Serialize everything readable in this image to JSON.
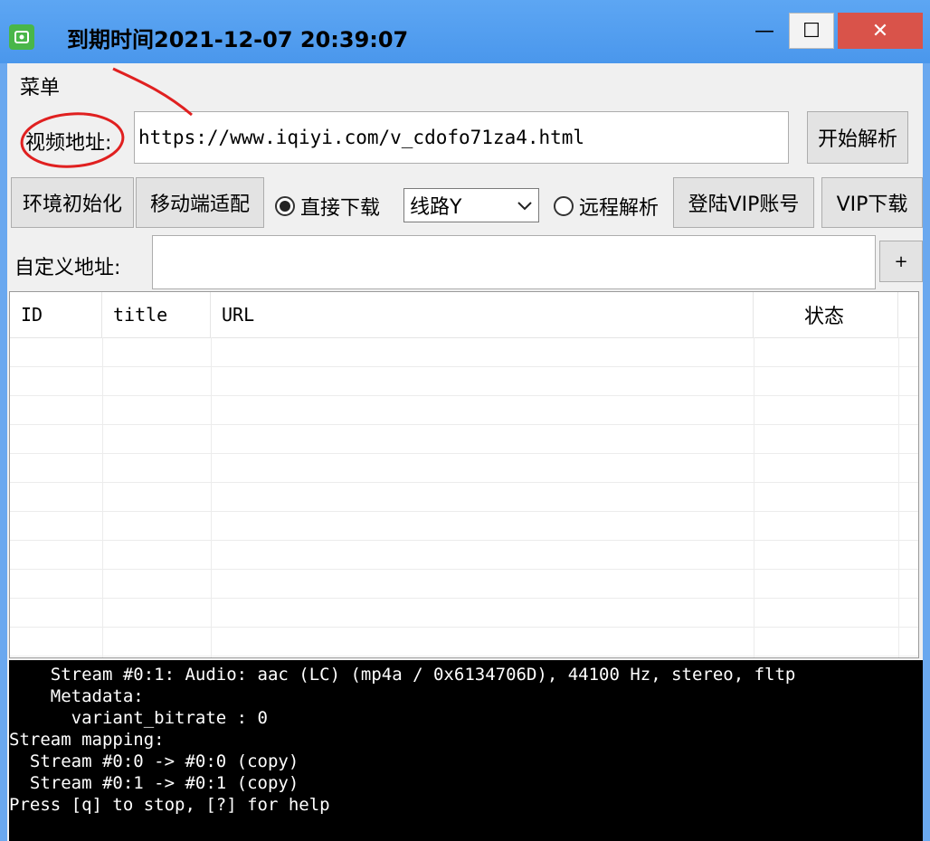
{
  "window": {
    "title": "到期时间2021-12-07 20:39:07",
    "min_glyph": "—",
    "max_glyph": "☐",
    "close_glyph": "✕",
    "icon": "app-logo-icon"
  },
  "menu": {
    "label": "菜单"
  },
  "video": {
    "label": "视频地址:",
    "url": "https://www.iqiyi.com/v_cdofo71za4.html",
    "parse_button": "开始解析"
  },
  "toolbar": {
    "init_button": "环境初始化",
    "mobile_button": "移动端适配",
    "direct_download": "直接下载",
    "route_selected": "线路Y",
    "remote_parse": "远程解析",
    "login_vip": "登陆VIP账号",
    "vip_download": "VIP下载"
  },
  "custom": {
    "label": "自定义地址:",
    "value": "",
    "add_button": "+"
  },
  "table": {
    "columns": [
      "ID",
      "title",
      "URL",
      "状态"
    ],
    "rows": []
  },
  "console": {
    "lines": [
      "    Stream #0:1: Audio: aac (LC) (mp4a / 0x6134706D), 44100 Hz, stereo, fltp",
      "    Metadata:",
      "      variant_bitrate : 0",
      "Stream mapping:",
      "  Stream #0:0 -> #0:0 (copy)",
      "  Stream #0:1 -> #0:1 (copy)",
      "Press [q] to stop, [?] for help"
    ]
  },
  "colors": {
    "titlebar": "#4a97ec",
    "close": "#d9534a",
    "annotation": "#e02020"
  }
}
